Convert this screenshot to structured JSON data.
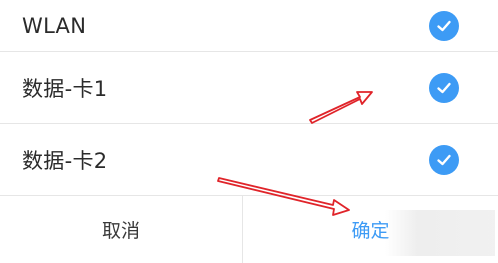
{
  "options": [
    {
      "label": "WLAN",
      "checked": true
    },
    {
      "label": "数据-卡1",
      "checked": true
    },
    {
      "label": "数据-卡2",
      "checked": true
    }
  ],
  "footer": {
    "cancel_label": "取消",
    "confirm_label": "确定"
  },
  "colors": {
    "accent": "#3d9bf5",
    "annotation_arrow": "#e0242a"
  }
}
